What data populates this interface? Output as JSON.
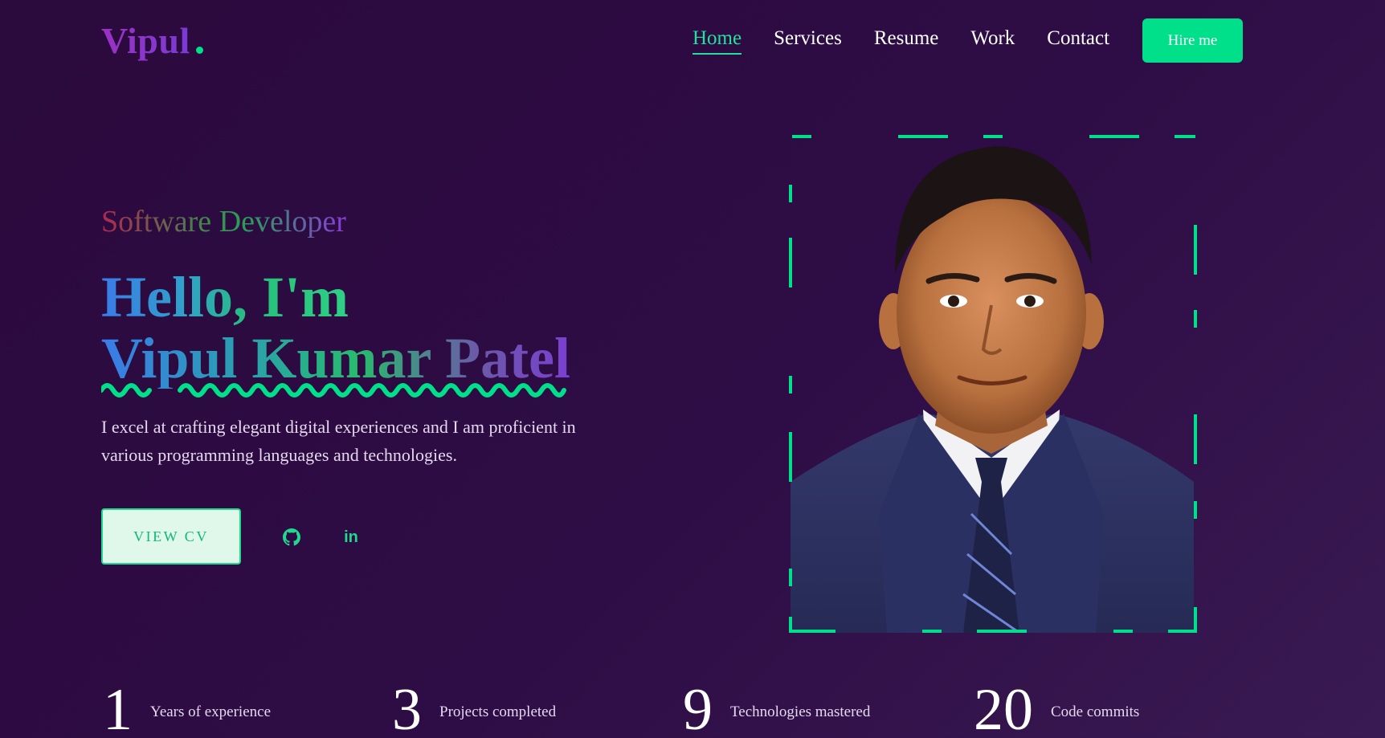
{
  "logo": {
    "text": "Vipul"
  },
  "nav": {
    "items": [
      {
        "label": "Home",
        "active": true
      },
      {
        "label": "Services",
        "active": false
      },
      {
        "label": "Resume",
        "active": false
      },
      {
        "label": "Work",
        "active": false
      },
      {
        "label": "Contact",
        "active": false
      }
    ],
    "hire_label": "Hire me"
  },
  "hero": {
    "subtitle": "Software Developer",
    "greeting": "Hello, I'm",
    "name": "Vipul Kumar Patel",
    "description": "I excel at crafting elegant digital experiences and I am proficient in various programming languages and technologies.",
    "cv_button": "VIEW CV",
    "social": [
      {
        "icon": "github-icon"
      },
      {
        "icon": "linkedin-icon",
        "glyph": "in"
      }
    ]
  },
  "stats": [
    {
      "value": "1",
      "label": "Years of experience"
    },
    {
      "value": "3",
      "label": "Projects completed"
    },
    {
      "value": "9",
      "label": "Technologies mastered"
    },
    {
      "value": "20",
      "label": "Code commits"
    }
  ],
  "colors": {
    "accent": "#00e08a",
    "background": "#2b0a3d",
    "text": "#ffffff"
  }
}
